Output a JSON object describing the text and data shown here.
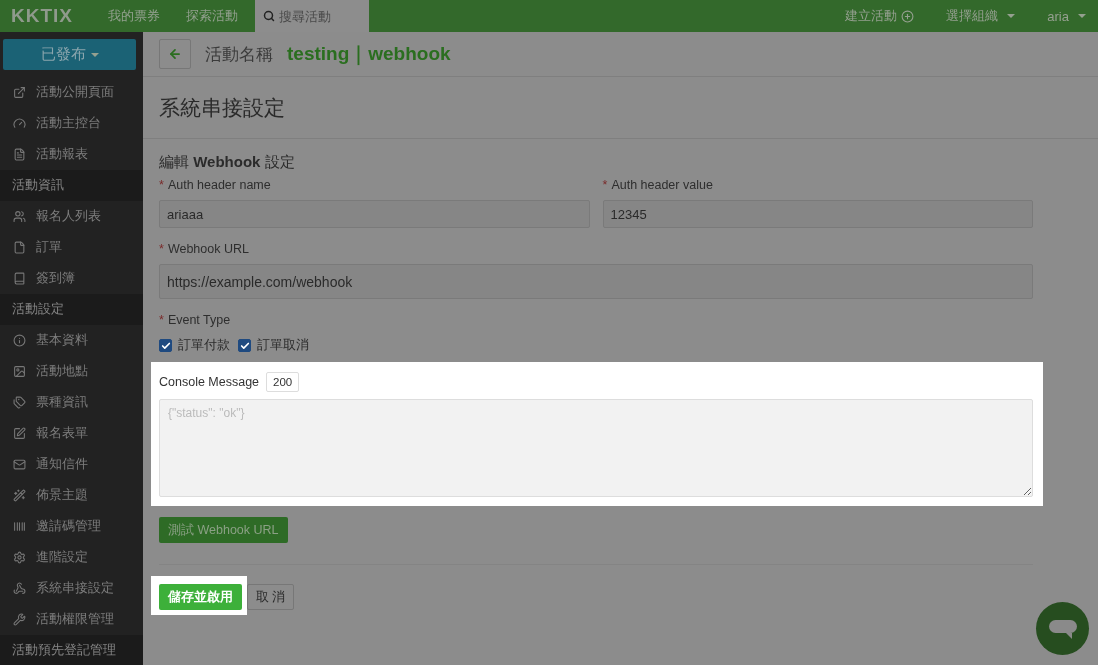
{
  "topbar": {
    "logo": "KKTIX",
    "nav": [
      "我的票券",
      "探索活動"
    ],
    "search": {
      "placeholder": "搜尋活動"
    },
    "create": "建立活動",
    "org": "選擇組織",
    "user": "aria"
  },
  "sidebar": {
    "status_button": "已發布",
    "items": [
      {
        "kind": "link",
        "label": "活動公開頁面"
      },
      {
        "kind": "link",
        "label": "活動主控台"
      },
      {
        "kind": "link",
        "label": "活動報表"
      },
      {
        "kind": "section",
        "label": "活動資訊"
      },
      {
        "kind": "link",
        "label": "報名人列表"
      },
      {
        "kind": "link",
        "label": "訂單"
      },
      {
        "kind": "link",
        "label": "簽到簿"
      },
      {
        "kind": "section",
        "label": "活動設定"
      },
      {
        "kind": "link",
        "label": "基本資料"
      },
      {
        "kind": "link",
        "label": "活動地點"
      },
      {
        "kind": "link",
        "label": "票種資訊"
      },
      {
        "kind": "link",
        "label": "報名表單"
      },
      {
        "kind": "link",
        "label": "通知信件"
      },
      {
        "kind": "link",
        "label": "佈景主題"
      },
      {
        "kind": "link",
        "label": "邀請碼管理"
      },
      {
        "kind": "link",
        "label": "進階設定"
      },
      {
        "kind": "link",
        "label": "系統串接設定"
      },
      {
        "kind": "link",
        "label": "活動權限管理"
      },
      {
        "kind": "section",
        "label": "活動預先登記管理"
      }
    ]
  },
  "header": {
    "event_label": "活動名稱",
    "event_name": "testing｜webhook"
  },
  "page_title": "系統串接設定",
  "form": {
    "section_title": "編輯 **Webhook** 設定",
    "auth_fields": [
      {
        "required_mark": "*",
        "label": "Auth header name",
        "value": "ariaaa"
      },
      {
        "required_mark": "*",
        "label": "Auth header value",
        "value": "12345"
      }
    ],
    "url_field": {
      "required_mark": "*",
      "label": "Webhook URL",
      "value": "https://example.com/webhook"
    },
    "event_type": {
      "required_mark": "*",
      "label": "Event Type",
      "options": [
        {
          "label": "訂單付款",
          "checked": true
        },
        {
          "label": "訂單取消",
          "checked": true
        }
      ]
    },
    "console": {
      "label": "Console Message",
      "status_code": "200",
      "placeholder": "{\"status\": \"ok\"}"
    },
    "test_button": "測試 Webhook URL",
    "save_button": "儲存並啟用",
    "cancel_button": "取 消"
  }
}
